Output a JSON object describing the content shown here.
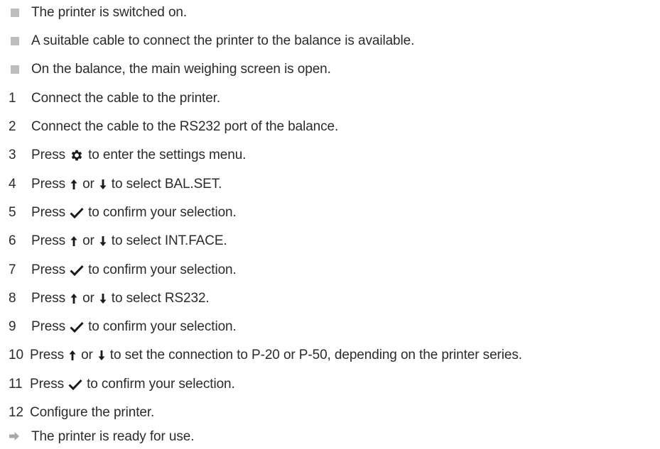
{
  "prerequisites": [
    "The printer is switched on.",
    "A suitable cable to connect the printer to the balance is available.",
    "On the balance, the main weighing screen is open."
  ],
  "steps": [
    {
      "num": "1",
      "text": "Connect the cable to the printer."
    },
    {
      "num": "2",
      "text": "Connect the cable to the RS232 port of the balance."
    },
    {
      "num": "3",
      "pre": "Press",
      "post": "to enter the settings menu."
    },
    {
      "num": "4",
      "pre": "Press",
      "mid": "or",
      "post": "to select  BAL.SET."
    },
    {
      "num": "5",
      "pre": "Press",
      "post": "to confirm your selection."
    },
    {
      "num": "6",
      "pre": "Press",
      "mid": "or",
      "post": "to select  INT.FACE."
    },
    {
      "num": "7",
      "pre": "Press",
      "post": "to confirm your selection."
    },
    {
      "num": "8",
      "pre": "Press",
      "mid": "or",
      "post": "to select RS232."
    },
    {
      "num": "9",
      "pre": "Press",
      "post": "to confirm your selection."
    },
    {
      "num": "10",
      "pre": "Press",
      "mid": "or",
      "post": "to set the connection to P-20 or P-50, depending on the printer series."
    },
    {
      "num": "11",
      "pre": "Press",
      "post": "to confirm your selection."
    },
    {
      "num": "12",
      "text": "Configure the printer."
    }
  ],
  "result": "The printer is ready for use.",
  "icons": {
    "settings": "gear-icon",
    "up": "arrow-up-icon",
    "down": "arrow-down-icon",
    "confirm": "checkmark-icon",
    "result": "result-arrow-icon",
    "bullet": "square-bullet-icon"
  },
  "colors": {
    "text": "#2b2b2b",
    "bullet": "#bdbdbd",
    "result_arrow": "#a8a8a8"
  }
}
